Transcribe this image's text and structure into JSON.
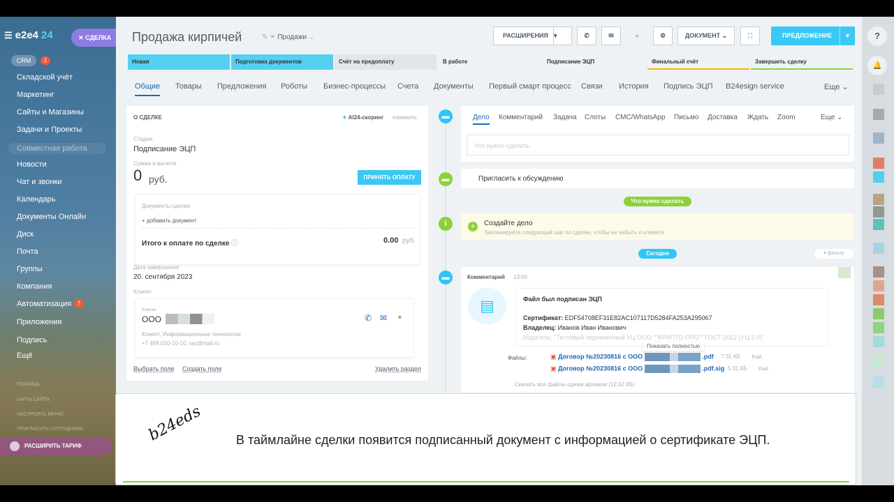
{
  "sidebar": {
    "logo": "e2e4",
    "logo_num": "24",
    "deal_button": "СДЕЛКА",
    "crm": "CRM",
    "crm_badge": "1",
    "items": [
      "Складской учёт",
      "Маркетинг",
      "Сайты и Магазины",
      "Задачи и Проекты"
    ],
    "group": "Совместная работа",
    "group_items": [
      "Новости",
      "Чат и звонки",
      "Календарь",
      "Документы Онлайн",
      "Диск",
      "Почта",
      "Группы",
      "Компания",
      "Автоматизация",
      "Приложения",
      "Подпись",
      "Ещё"
    ],
    "automation_badge": "7",
    "small": [
      "ПОМОЩЬ",
      "КАРТА САЙТА",
      "НАСТРОИТЬ МЕНЮ",
      "ПРИГЛАСИТЬ СОТРУДНИКА"
    ],
    "upgrade": "РАСШИРИТЬ ТАРИФ"
  },
  "header": {
    "title": "Продажа кирпичей",
    "funnel": "Продажи",
    "extensions": "РАСШИРЕНИЯ",
    "document": "ДОКУМЕНТ",
    "offer": "ПРЕДЛОЖЕНИЕ"
  },
  "stages": [
    {
      "label": "Новая",
      "color": "#55d0f0"
    },
    {
      "label": "Подготовка документов",
      "color": "#55d0f0"
    },
    {
      "label": "Счёт на предоплату",
      "color": "#55d0f0"
    },
    {
      "label": "В работе",
      "color": "#55d0f0"
    },
    {
      "label": "Подписание ЭЦП",
      "color": "#55d0f0"
    },
    {
      "label": "Финальный счёт",
      "color": "#e3e6e9"
    },
    {
      "label": "Завершить сделку",
      "color": "#e3e6e9"
    }
  ],
  "tabs": [
    "Общие",
    "Товары",
    "Предложения",
    "Роботы",
    "Бизнес-процессы",
    "Счета",
    "Документы",
    "Первый смарт процесс",
    "Связи",
    "История",
    "Подпись ЭЦП",
    "B24esign service",
    "Еще"
  ],
  "deal": {
    "section": "О СДЕЛКЕ",
    "scoring": "AI24-скоринг",
    "edit": "изменить",
    "stage_label": "Стадия",
    "stage": "Подписание ЭЦП",
    "sum_label": "Сумма и валюта",
    "sum": "0",
    "currency": "руб.",
    "accept": "ПРИНЯТЬ ОПЛАТУ",
    "docs_label": "Документы сделки",
    "add_doc": "+ добавить документ",
    "total_label": "Итого к оплате по сделке",
    "total": "0.00",
    "total_cur": "руб.",
    "close_label": "Дата завершения",
    "close_date": "20. сентября 2023",
    "client_label": "Клиент",
    "company_label": "Компан",
    "company": "ООО",
    "client_desc": "Клиент, Информационные технологии",
    "client_contact": "+7 499 010-10-10, rac@mail.ru",
    "select_field": "Выбрать поле",
    "create_field": "Создать поле",
    "delete_section": "Удалить раздел"
  },
  "activity": {
    "tabs": [
      "Дело",
      "Комментарий",
      "Задача",
      "Слоты",
      "СМС/WhatsApp",
      "Письмо",
      "Доставка",
      "Ждать",
      "Zoom",
      "Еще"
    ],
    "placeholder": "Что нужно сделать",
    "invite": "Пригласить к обсуждению",
    "todo_pill": "Что нужно сделать",
    "create_title": "Создайте дело",
    "create_hint": "Запланируйте следующий шаг по сделке, чтобы не забыть о клиенте",
    "today_pill": "Сегодня",
    "filter": "фильтр"
  },
  "comment": {
    "label": "Комментарий",
    "time": "13:00",
    "signed": "Файл был подписан ЭЦП",
    "cert_label": "Сертификат:",
    "cert": "EDF54708EF31E82AC107117D5284FA253A295067",
    "owner_label": "Владелец:",
    "owner": "Иванов Иван Иванович",
    "issuer": "Издатель: \"Тестовый подчиненный УЦ ООО \"\"КРИПТО-ПРО\"\" ГОСТ 2012 (УЦ 2.0)\"",
    "show_full": "Показать полностью",
    "files_label": "Файлы:",
    "files": [
      {
        "name": "Договор №20230816 с ООО",
        "ext": ".pdf",
        "size": "7.31 КБ",
        "more": "Ещё"
      },
      {
        "name": "Договор №20230816 с ООО",
        "ext": ".pdf.sig",
        "size": "5.31 КБ",
        "more": "Ещё"
      }
    ],
    "download": "Скачать все файлы одним архивом (12.62 КБ)"
  },
  "caption": {
    "signature": "b24eds",
    "text": "В таймлайне сделки появится подписанный документ с информацией о сертификате ЭЦП."
  },
  "rail": {
    "help": "?",
    "bell": "🔔",
    "swatches": [
      "#c8cbcf",
      "#a4a9ae",
      "#9eb4c8",
      "#e07c67",
      "#4fd0ef",
      "#b8a286",
      "#8f9a93",
      "#5fc1b5",
      "#a9d2e3",
      "#a69182",
      "#e1a58f",
      "#e0896a",
      "#8ccc6a",
      "#8fd57c",
      "#a3d9e0",
      "#c5e8d0",
      "#b4dfe7"
    ]
  }
}
